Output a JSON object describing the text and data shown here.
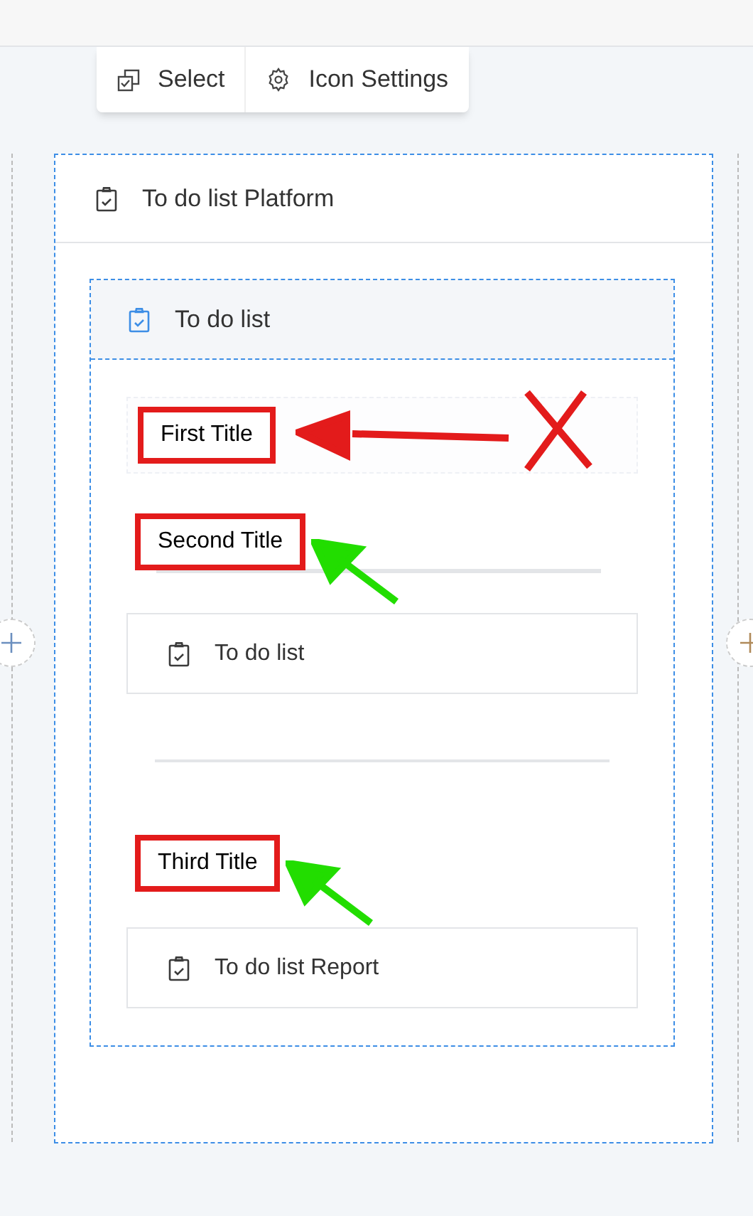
{
  "toolbar": [
    {
      "label": "Select",
      "kind": "select"
    },
    {
      "label": "Icon Settings",
      "kind": "settings"
    }
  ],
  "platform": {
    "title": "To do list Platform",
    "list": {
      "title": "To do list",
      "blocks": [
        {
          "kind": "title",
          "text": "First Title",
          "framed": true,
          "highlighted": true,
          "arrow": {
            "color": "#e31b1b",
            "kind": "horizontal"
          },
          "crossed": true
        },
        {
          "kind": "title",
          "text": "Second Title",
          "framed": false,
          "highlighted": true,
          "underlined": true,
          "arrow": {
            "color": "#22dd00",
            "kind": "diagonal"
          },
          "crossed": false
        },
        {
          "kind": "card",
          "title": "To do list"
        },
        {
          "kind": "divider"
        },
        {
          "kind": "title",
          "text": "Third Title",
          "framed": false,
          "highlighted": true,
          "arrow": {
            "color": "#22dd00",
            "kind": "diagonal"
          },
          "crossed": false
        },
        {
          "kind": "card",
          "title": "To do list Report"
        }
      ]
    }
  }
}
